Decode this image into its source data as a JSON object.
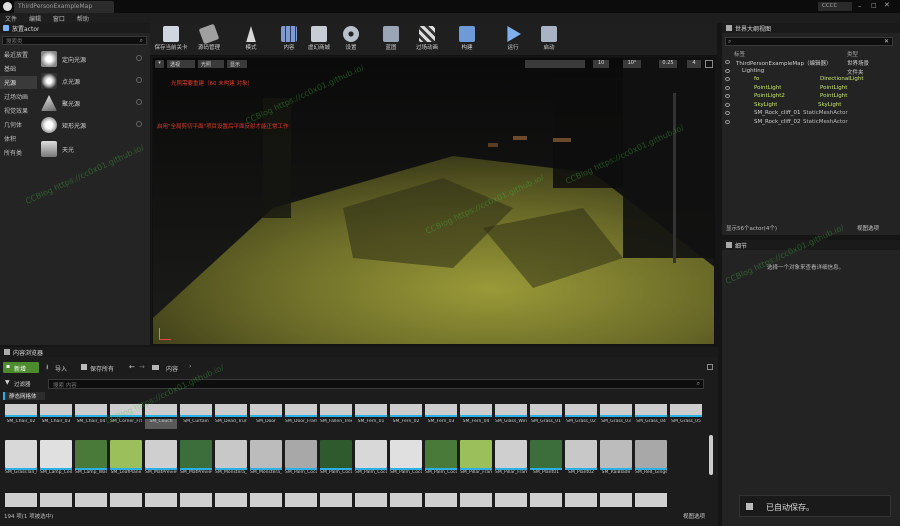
{
  "window": {
    "tab_title": "ThirdPersonExampleMap",
    "badge": "CCCC"
  },
  "menu": [
    "文件",
    "编辑",
    "窗口",
    "帮助"
  ],
  "place_panel": {
    "title": "放置actor",
    "search_placeholder": "搜索类",
    "categories": [
      "最近放置",
      "基础",
      "光源",
      "过场动画",
      "视觉效果",
      "几何体",
      "体积",
      "所有类"
    ],
    "items": [
      {
        "label": "定向光源",
        "icon": "directional-light-icon"
      },
      {
        "label": "点光源",
        "icon": "point-light-icon"
      },
      {
        "label": "聚光源",
        "icon": "spot-light-icon"
      },
      {
        "label": "矩形光源",
        "icon": "rect-light-icon"
      },
      {
        "label": "天光",
        "icon": "sky-light-icon"
      }
    ]
  },
  "toolbar": [
    {
      "label": "保存当前关卡",
      "icon": "save-icon"
    },
    {
      "label": "源码管理",
      "icon": "source-control-icon"
    },
    {
      "label": "模式",
      "icon": "modes-icon"
    },
    {
      "label": "内容",
      "icon": "content-icon"
    },
    {
      "label": "虚幻商城",
      "icon": "marketplace-icon"
    },
    {
      "label": "设置",
      "icon": "settings-icon"
    },
    {
      "label": "蓝图",
      "icon": "blueprint-icon"
    },
    {
      "label": "过场动画",
      "icon": "cinematics-icon"
    },
    {
      "label": "构建",
      "icon": "build-icon"
    },
    {
      "label": "运行",
      "icon": "play-icon"
    },
    {
      "label": "启动",
      "icon": "launch-icon"
    }
  ],
  "viewport": {
    "btn_perspective": "透视",
    "btn_lit": "光照",
    "btn_show": "显示",
    "warning1": "光照需要重建（60 未构建 对象）",
    "warning2": "启用\"全局剪切平面\"项目设置后平面反射才能正常工作",
    "grid": "10",
    "angle": "10°",
    "scale": "0.25",
    "cam": "4"
  },
  "outliner": {
    "title": "世界大纲视图",
    "col_label": "标签",
    "col_type": "类型",
    "rows": [
      {
        "label": "ThirdPersonExampleMap（编辑器）",
        "type": "世界场景",
        "color": "#d0d0d0"
      },
      {
        "label": "Lighting",
        "type": "文件夹",
        "color": "#d0d0d0"
      },
      {
        "label": "fo",
        "type": "DirectionalLight",
        "color": "#c8e86a"
      },
      {
        "label": "PointLight",
        "type": "PointLight",
        "color": "#c8e86a"
      },
      {
        "label": "PointLight2",
        "type": "PointLight",
        "color": "#c8e86a"
      },
      {
        "label": "SkyLight",
        "type": "SkyLight",
        "color": "#c8e86a"
      },
      {
        "label": "SM_Rock_cliff_01",
        "type": "StaticMeshActor",
        "color": "#d0d0d0"
      },
      {
        "label": "SM_Rock_cliff_02",
        "type": "StaticMeshActor",
        "color": "#d0d0d0"
      }
    ],
    "footer": "显示56个actor(4个)",
    "view_options": "视图选项"
  },
  "details": {
    "title": "细节",
    "empty_msg": "选择一个对象来查看详细信息。"
  },
  "content_browser": {
    "title": "内容浏览器",
    "add_new": "新增",
    "import": "导入",
    "save_all": "保存所有",
    "path": "内容",
    "filters": "过滤器",
    "search_placeholder": "搜索 内容",
    "collection": "静态网格体",
    "row1": [
      "SM_Chair_02",
      "SM_Chair_03",
      "SM_Chair_04",
      "SM_Corner_Frame",
      "SM_Couch",
      "SM_Curtain",
      "SM_Dead_Trunk",
      "SM_Door",
      "SM_Door_Frame",
      "SM_Fallen_Tree",
      "SM_Fern_01",
      "SM_Fern_02",
      "SM_Fern_03",
      "SM_Fern_04",
      "SM_Glass_Window",
      "SM_Grass_01",
      "SM_Grass_02",
      "SM_Grass_03",
      "SM_Grass_04",
      "SM_Grass_05"
    ],
    "row2": [
      "SM_GrassTall_01",
      "SM_Lamp_Ceiling",
      "SM_Lamp_Wall",
      "SM_LeafPlane",
      "SM_MatPreviewMesh_01",
      "SM_MatPreviewMesh_02",
      "SM_Monstera_01",
      "SM_Monstera_02",
      "SM_Palm_Coconut_01",
      "SM_Palm_Coconut_02",
      "SM_Palm_Coconut_03",
      "SM_Palm_Coconut_04",
      "SM_Palm_Coconut_05",
      "SM_Pillar_Frame",
      "SM_Pillar_Frame300",
      "SM_Plant01",
      "SM_Plant02",
      "SM_RaiBlade",
      "SM_Red_Ginger_01"
    ],
    "status": "194 项(1 项被选中)",
    "view_options": "视图选项"
  },
  "toast": "已自动保存。",
  "watermark": "CCBlog https://cc0x01.github.io/"
}
